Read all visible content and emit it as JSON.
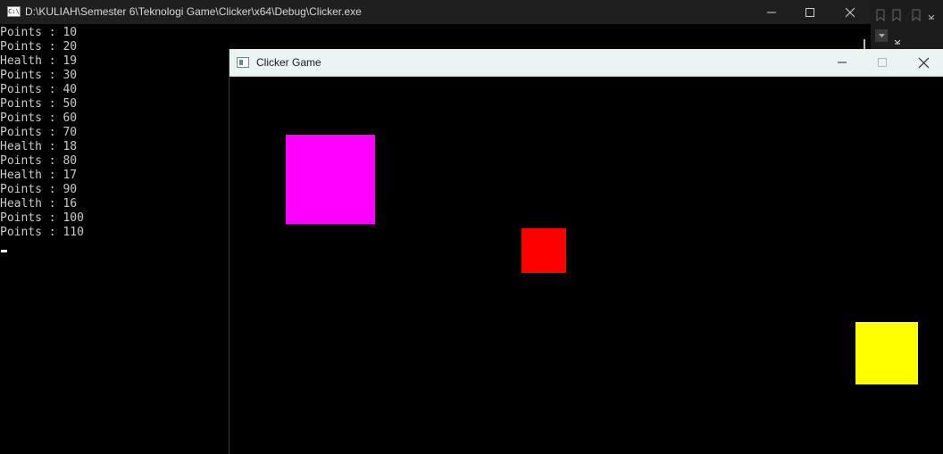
{
  "console": {
    "title": "D:\\KULIAH\\Semester 6\\Teknologi Game\\Clicker\\x64\\Debug\\Clicker.exe",
    "icon_text": "C:\\",
    "lines": [
      "Points : 10",
      "Points : 20",
      "Health : 19",
      "Points : 30",
      "Points : 40",
      "Points : 50",
      "Points : 60",
      "Points : 70",
      "Health : 18",
      "Points : 80",
      "Health : 17",
      "Points : 90",
      "Health : 16",
      "Points : 100",
      "Points : 110"
    ]
  },
  "game": {
    "title": "Clicker Game",
    "colors": {
      "magenta": "#ff00ff",
      "red": "#ff0000",
      "yellow": "#ffff00"
    }
  },
  "icons": {
    "minimize": "minimize-icon",
    "maximize": "maximize-icon",
    "close": "close-icon"
  }
}
